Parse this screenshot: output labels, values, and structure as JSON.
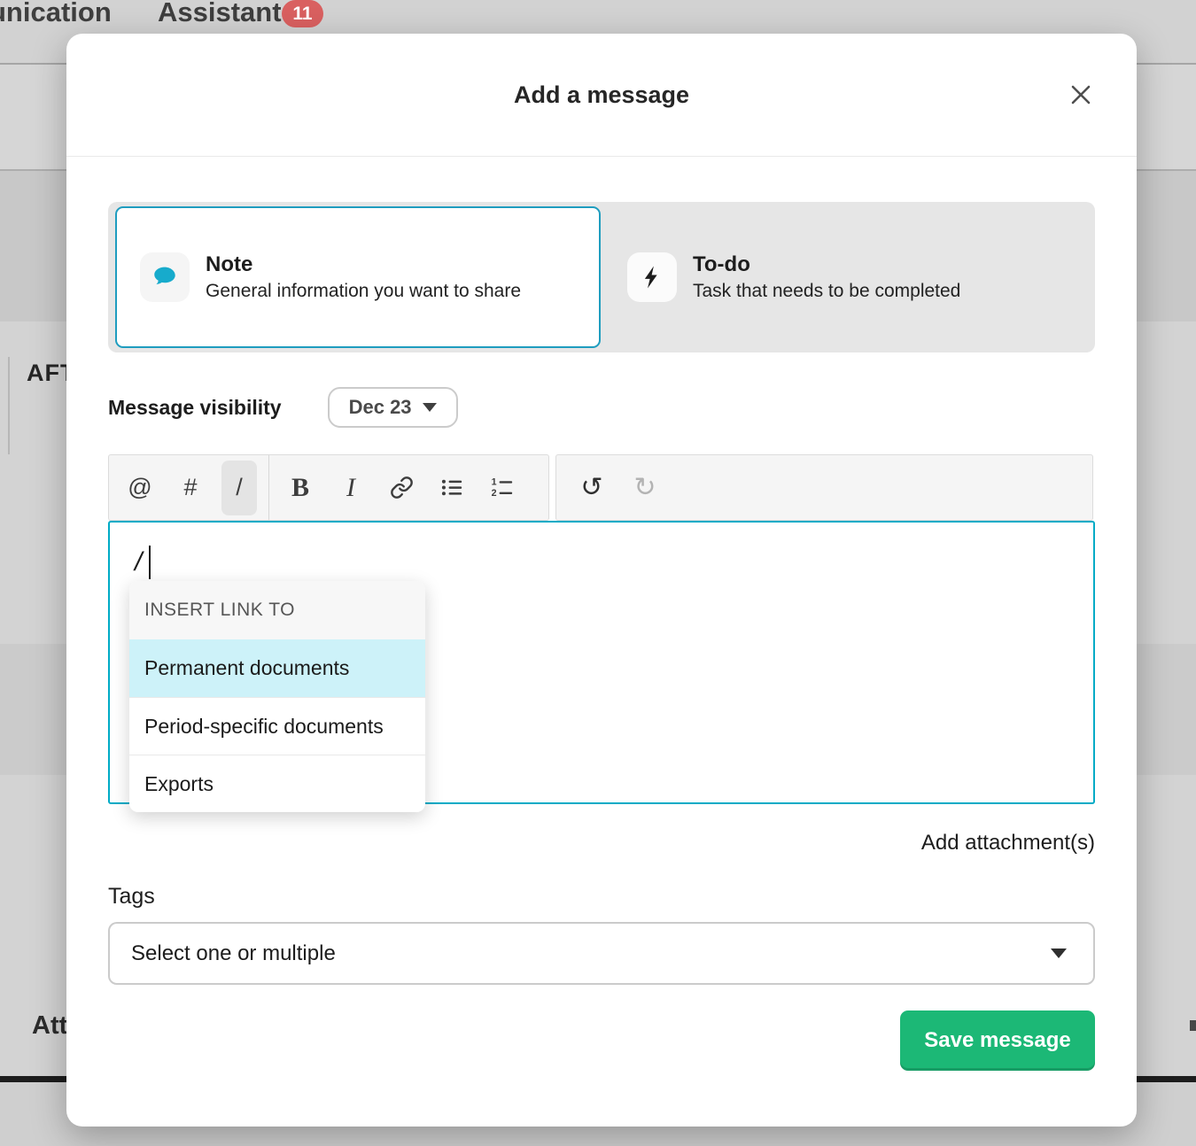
{
  "page": {
    "tabs": {
      "communication_partial": "unication",
      "assistant": "Assistant",
      "assistant_badge": "11"
    },
    "left_labels": {
      "top_partial": "AFT",
      "bottom_partial": "Att"
    }
  },
  "modal": {
    "title": "Add a message",
    "message_types": {
      "note": {
        "title": "Note",
        "description": "General information you want to share"
      },
      "todo": {
        "title": "To-do",
        "description": "Task that needs to be completed"
      }
    },
    "visibility": {
      "label": "Message visibility",
      "value": "Dec 23"
    },
    "toolbar": {
      "mention": "@",
      "hashtag": "#",
      "slash": "/",
      "bold": "B",
      "italic": "I",
      "undo": "↺",
      "redo": "↻"
    },
    "editor": {
      "content": "/"
    },
    "slash_menu": {
      "header": "INSERT LINK TO",
      "options": [
        "Permanent documents",
        "Period-specific documents",
        "Exports"
      ],
      "highlighted": "Permanent documents"
    },
    "attachments_link": "Add attachment(s)",
    "tags": {
      "label": "Tags",
      "placeholder": "Select one or multiple"
    },
    "save_button": "Save message"
  },
  "colors": {
    "note_card_border": "#1f9dbf",
    "note_bubble_teal": "#17abcc",
    "editor_border": "#00abc6",
    "highlight_row": "#cdf2f9",
    "save_green": "#1cb876",
    "badge_red": "#d96060"
  }
}
